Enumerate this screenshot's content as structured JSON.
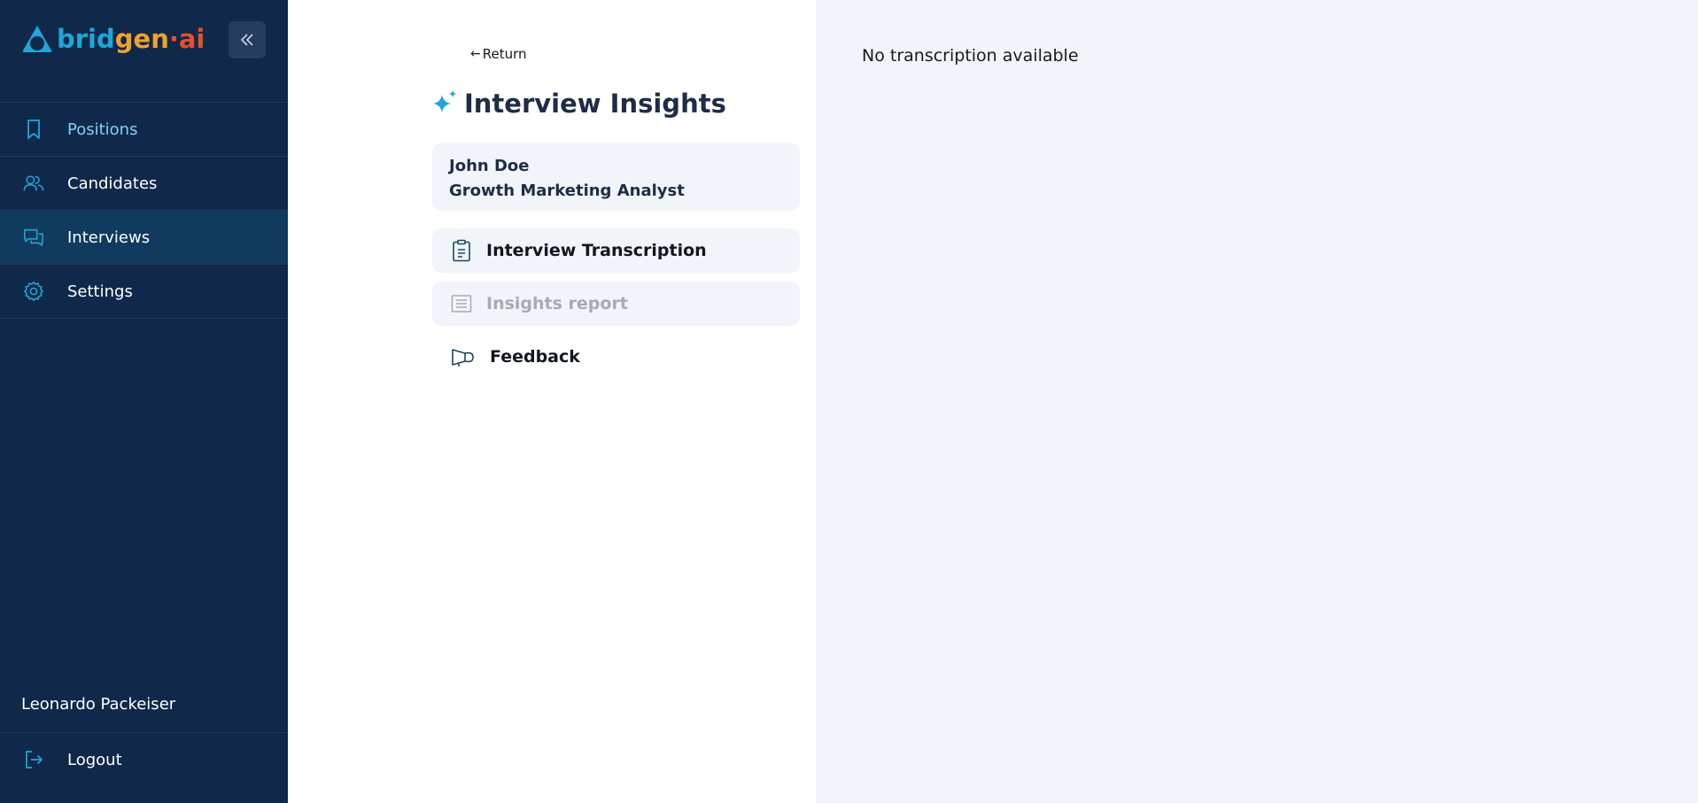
{
  "brand": {
    "logo_part1": "brid",
    "logo_part2": "gen",
    "logo_part3": "·ai",
    "colors": {
      "blue": "#1fa6d8",
      "orange": "#f0a030",
      "red": "#e2502f"
    }
  },
  "sidebar": {
    "collapse_icon": "double-chevron-left-icon",
    "items": [
      {
        "label": "Positions",
        "icon": "bookmark-icon"
      },
      {
        "label": "Candidates",
        "icon": "users-icon"
      },
      {
        "label": "Interviews",
        "icon": "chat-bubbles-icon"
      },
      {
        "label": "Settings",
        "icon": "gear-icon"
      }
    ],
    "user_name": "Leonardo Packeiser",
    "logout_label": "Logout"
  },
  "middle": {
    "return_label": "Return",
    "title": "Interview Insights",
    "candidate": {
      "name": "John Doe",
      "role": "Growth Marketing Analyst"
    },
    "sections": {
      "transcription": "Interview Transcription",
      "insights": "Insights report",
      "feedback": "Feedback"
    }
  },
  "right": {
    "message": "No transcription available"
  }
}
